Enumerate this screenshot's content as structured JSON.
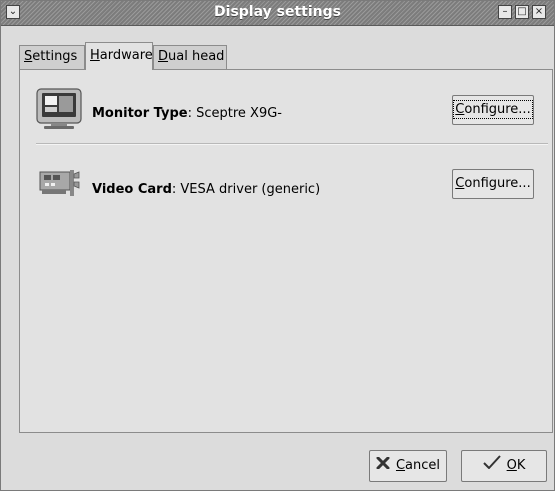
{
  "window": {
    "title": "Display settings",
    "menu_glyph": "⌄",
    "minimize_glyph": "–",
    "maximize_glyph": "□",
    "close_glyph": "×"
  },
  "tabs": [
    {
      "mnemonic": "S",
      "rest": "ettings",
      "active": false
    },
    {
      "mnemonic": "H",
      "rest": "ardware",
      "active": true
    },
    {
      "mnemonic": "D",
      "rest": "ual head",
      "active": false
    }
  ],
  "hardware": {
    "monitor": {
      "icon": "monitor-icon",
      "label": "Monitor Type",
      "value": ": Sceptre X9G-",
      "configure_mnemonic": "C",
      "configure_rest": "onfigure..."
    },
    "video": {
      "icon": "video-card-icon",
      "label": "Video Card",
      "value": ": VESA driver (generic)",
      "configure_mnemonic": "C",
      "configure_rest": "onfigure..."
    }
  },
  "buttons": {
    "cancel_icon": "cancel-icon",
    "cancel_mnemonic": "C",
    "cancel_rest": "ancel",
    "ok_icon": "ok-icon",
    "ok_mnemonic": "O",
    "ok_rest": "K"
  }
}
